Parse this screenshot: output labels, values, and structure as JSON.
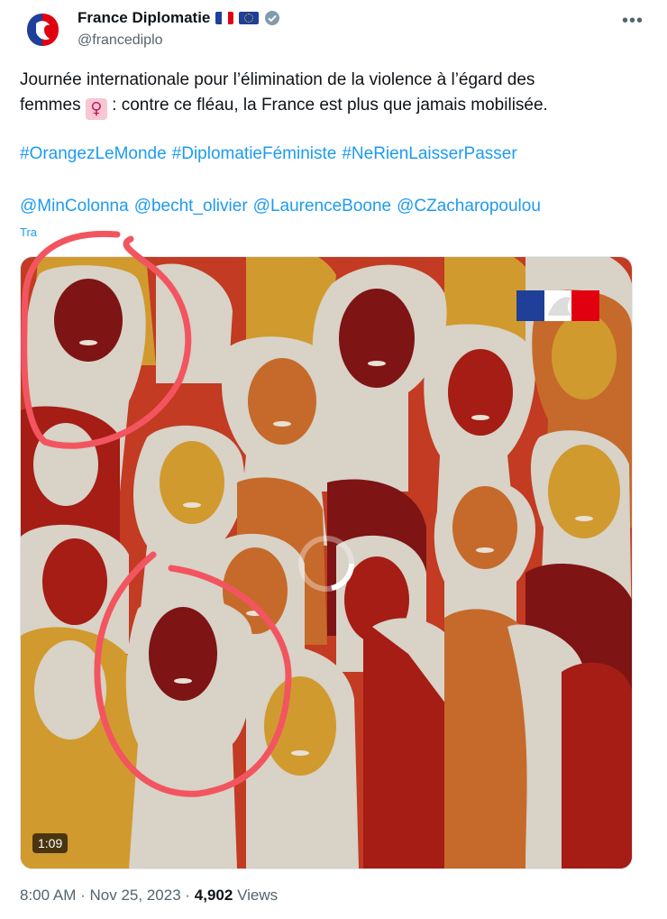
{
  "account": {
    "name": "France Diplomatie",
    "handle": "@francediplo"
  },
  "tweet": {
    "text_line1": "Journée internationale pour l’élimination de la violence à l’égard des",
    "text_line2_pre": "femmes",
    "text_line2_emoji": "♀",
    "text_line2_post": ": contre ce fléau, la France est plus que jamais mobilisée.",
    "hashtags": [
      "#OrangezLeMonde",
      "#DiplomatieFéministe",
      "#NeRienLaisserPasser"
    ],
    "mentions": [
      "@MinColonna",
      "@becht_olivier",
      "@LaurenceBoone",
      "@CZacharopoulou"
    ],
    "translate_label": "Tra"
  },
  "video": {
    "duration": "1:09"
  },
  "meta": {
    "time": "8:00 AM",
    "separator": "·",
    "date": "Nov 25, 2023",
    "views_count": "4,902",
    "views_label": "Views"
  },
  "colors": {
    "brand_blue": "#1d9bf0",
    "annotation_red": "#f2555f",
    "illustration_bg": "#c23b22"
  },
  "icons": {
    "more": "more-icon",
    "verified": "verified-badge-icon",
    "loading": "loading-spinner-icon"
  }
}
